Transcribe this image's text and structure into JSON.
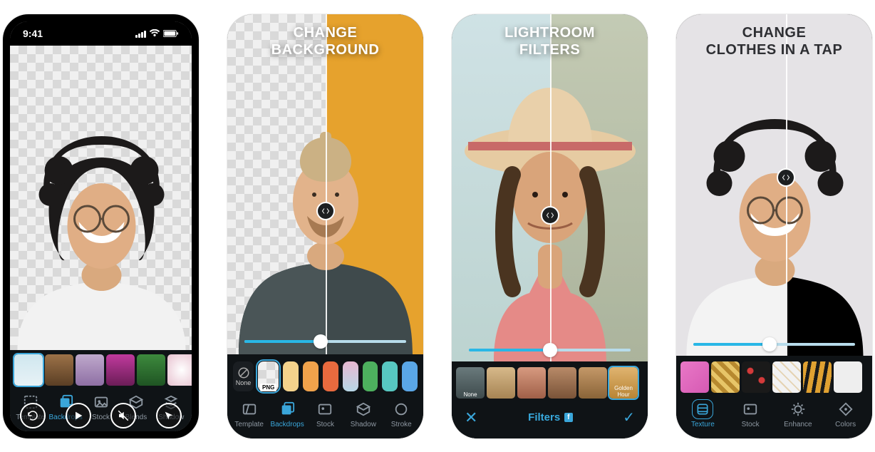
{
  "statusbar": {
    "time": "9:41"
  },
  "screens": [
    {
      "headline": "",
      "tabs": [
        "Template",
        "Backdrops",
        "Stock",
        "Blends",
        "Shadow"
      ],
      "active_tab": 1,
      "overlay_icons": [
        "refresh-icon",
        "play-icon",
        "mute-icon",
        "cursor-icon"
      ]
    },
    {
      "headline": "CHANGE\nBACKGROUND",
      "swatches": {
        "none": "None",
        "png": "PNG"
      },
      "slider_percent": 47,
      "tabs": [
        "Template",
        "Backdrops",
        "Stock",
        "Shadow",
        "Stroke"
      ],
      "active_tab": 1
    },
    {
      "headline": "LIGHTROOM\nFILTERS",
      "slider_percent": 50,
      "thumbs_none": "None",
      "thumbs_last": "Golden Hour",
      "action_title": "Filters",
      "badge": "f"
    },
    {
      "headline": "CHANGE\nCLOTHES IN A TAP",
      "slider_percent": 47,
      "tabs": [
        "Texture",
        "Stock",
        "Enhance",
        "Colors"
      ],
      "active_tab": 0
    }
  ],
  "colors": {
    "accent": "#3aa6da",
    "panel": "#0f1316",
    "orange": "#e6a22d"
  }
}
